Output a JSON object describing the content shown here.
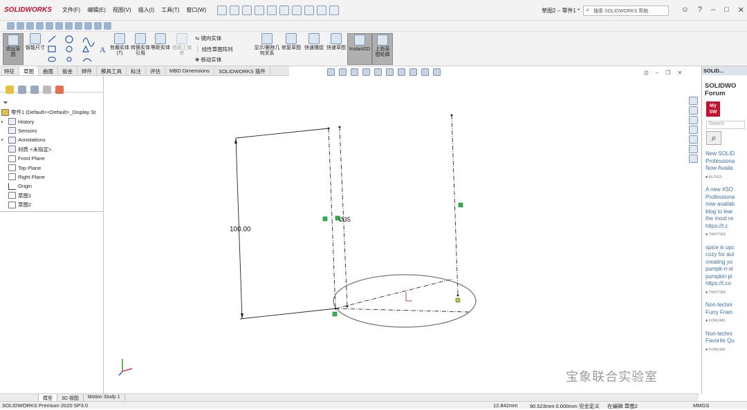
{
  "app": {
    "logo": "SOLIDWORKS",
    "menu": [
      "文件(F)",
      "编辑(E)",
      "视图(V)",
      "插入(I)",
      "工具(T)",
      "窗口(W)"
    ],
    "doc_title": "草图2 – 零件1 *",
    "search_placeholder": "搜索 SOLIDWORKS 帮助"
  },
  "command_manager": {
    "items": [
      {
        "label": "退出草图"
      },
      {
        "label": "智能尺寸"
      },
      {
        "label": "剪裁实体(T)"
      },
      {
        "label": "转换实体引用"
      },
      {
        "label": "等距实体"
      },
      {
        "label": "曲面上偏移"
      },
      {
        "label": "显示/删除几何关系"
      },
      {
        "label": "修复草图"
      },
      {
        "label": "快速捕捉"
      },
      {
        "label": "快速草图"
      },
      {
        "label": "Instant2D"
      },
      {
        "label": "上色草图轮廓"
      }
    ],
    "mini": [
      "镜向实体",
      "线性草图阵列",
      "移动实体"
    ]
  },
  "tabs": [
    "特征",
    "草图",
    "曲面",
    "钣金",
    "焊件",
    "模具工具",
    "标注",
    "评估",
    "MBD Dimensions",
    "SOLIDWORKS 插件"
  ],
  "active_tab": "草图",
  "tree": {
    "root": "零件1  (Default<<Default>_Display St",
    "items": [
      {
        "label": "History",
        "expandable": true
      },
      {
        "label": "Sensors",
        "expandable": false
      },
      {
        "label": "Annotations",
        "expandable": true
      },
      {
        "label": "材质 <未指定>",
        "expandable": false
      },
      {
        "label": "Front Plane",
        "expandable": false
      },
      {
        "label": "Top Plane",
        "expandable": false
      },
      {
        "label": "Right Plane",
        "expandable": false
      },
      {
        "label": "Origin",
        "expandable": false
      },
      {
        "label": "草图1",
        "expandable": false
      },
      {
        "label": "草图2",
        "expandable": false
      }
    ]
  },
  "sketch": {
    "dimension_left": "100.00",
    "dimension_mid": "Ø35"
  },
  "taskpane": {
    "header": "SOLID...",
    "title_line1": "SOLIDWO",
    "title_line2": "Forum",
    "mysw": "My SW",
    "search_placeholder": "Search",
    "posts": [
      {
        "lines": [
          "New SOLID",
          "Professiona",
          "Now Availa"
        ],
        "source": "BLOGS"
      },
      {
        "lines": [
          "A new #SO",
          "Professiona",
          "now availab",
          "blog to lear",
          "the most re",
          "https://t.c"
        ],
        "source": "TWITTER"
      },
      {
        "lines": [
          "spice is upc",
          "cozy for aut",
          "creating yo",
          "pumpk-n-sl",
          "pumpkin pi",
          "https://t.co"
        ],
        "source": "TWITTER"
      },
      {
        "lines": [
          "Non-techni",
          "Furry Frien"
        ],
        "source": "FORUMS"
      },
      {
        "lines": [
          "Non-techni",
          "Favorite Qu"
        ],
        "source": "FORUMS"
      }
    ]
  },
  "bottom_tabs": [
    "模型",
    "3D 视图",
    "Motion Study 1"
  ],
  "active_bottom_tab": "模型",
  "status": {
    "product": "SOLIDWORKS Premium 2020 SP3.0",
    "x": "12.842mm",
    "y": "90.523mm 0.000mm 完全定义",
    "mode": "在编辑 草图2",
    "units": "MMGS"
  },
  "watermark": "宝象联合实验室"
}
